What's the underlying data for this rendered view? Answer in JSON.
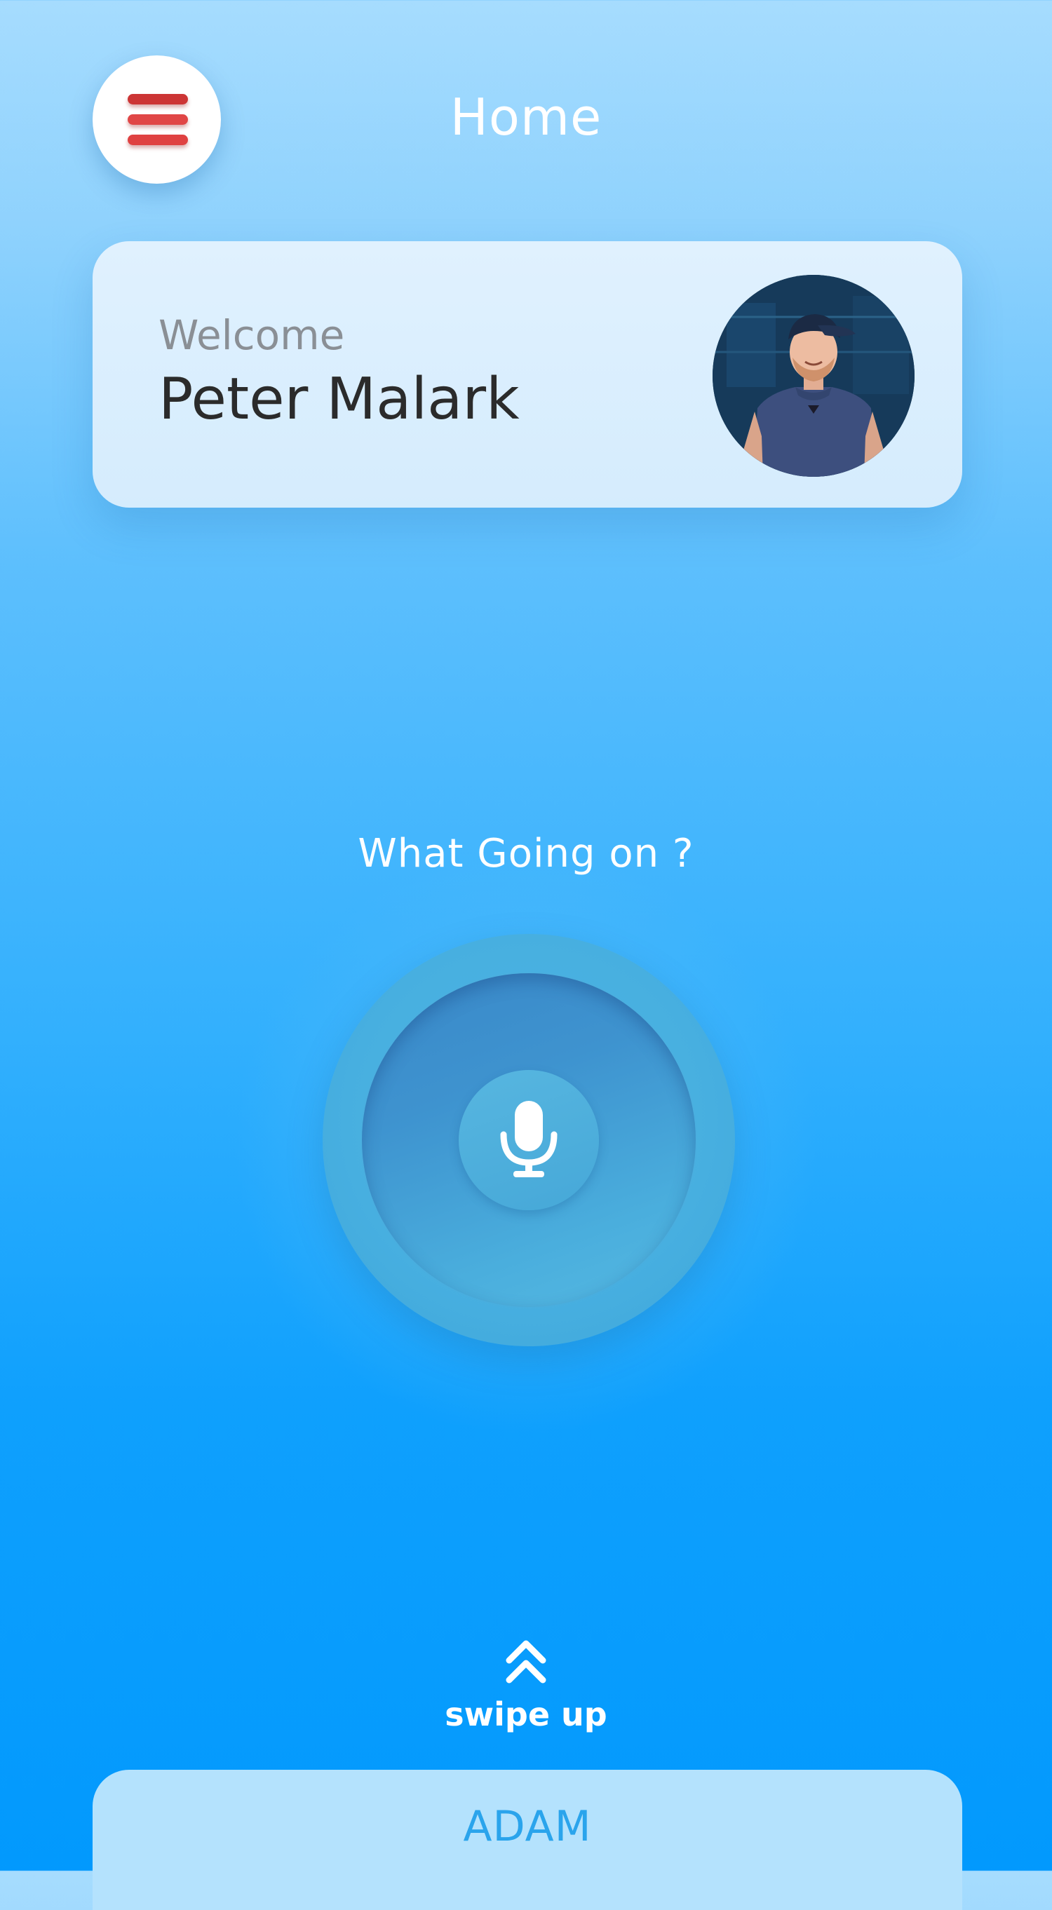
{
  "header": {
    "title": "Home",
    "menu_icon": "hamburger-menu-icon"
  },
  "welcome_card": {
    "greeting": "Welcome",
    "user_name": "Peter Malark",
    "avatar": "user-avatar-photo"
  },
  "voice": {
    "prompt": "What Going on ?",
    "mic_icon": "microphone-icon"
  },
  "swipe": {
    "icon": "double-chevron-up-icon",
    "label": "swipe up"
  },
  "bottom_sheet": {
    "label": "ADAM"
  },
  "colors": {
    "accent_red": "#d63c3c",
    "sheet_text": "#2aa4ec",
    "background_bottom": "#0299fd",
    "background_top": "#a6dcfe"
  }
}
